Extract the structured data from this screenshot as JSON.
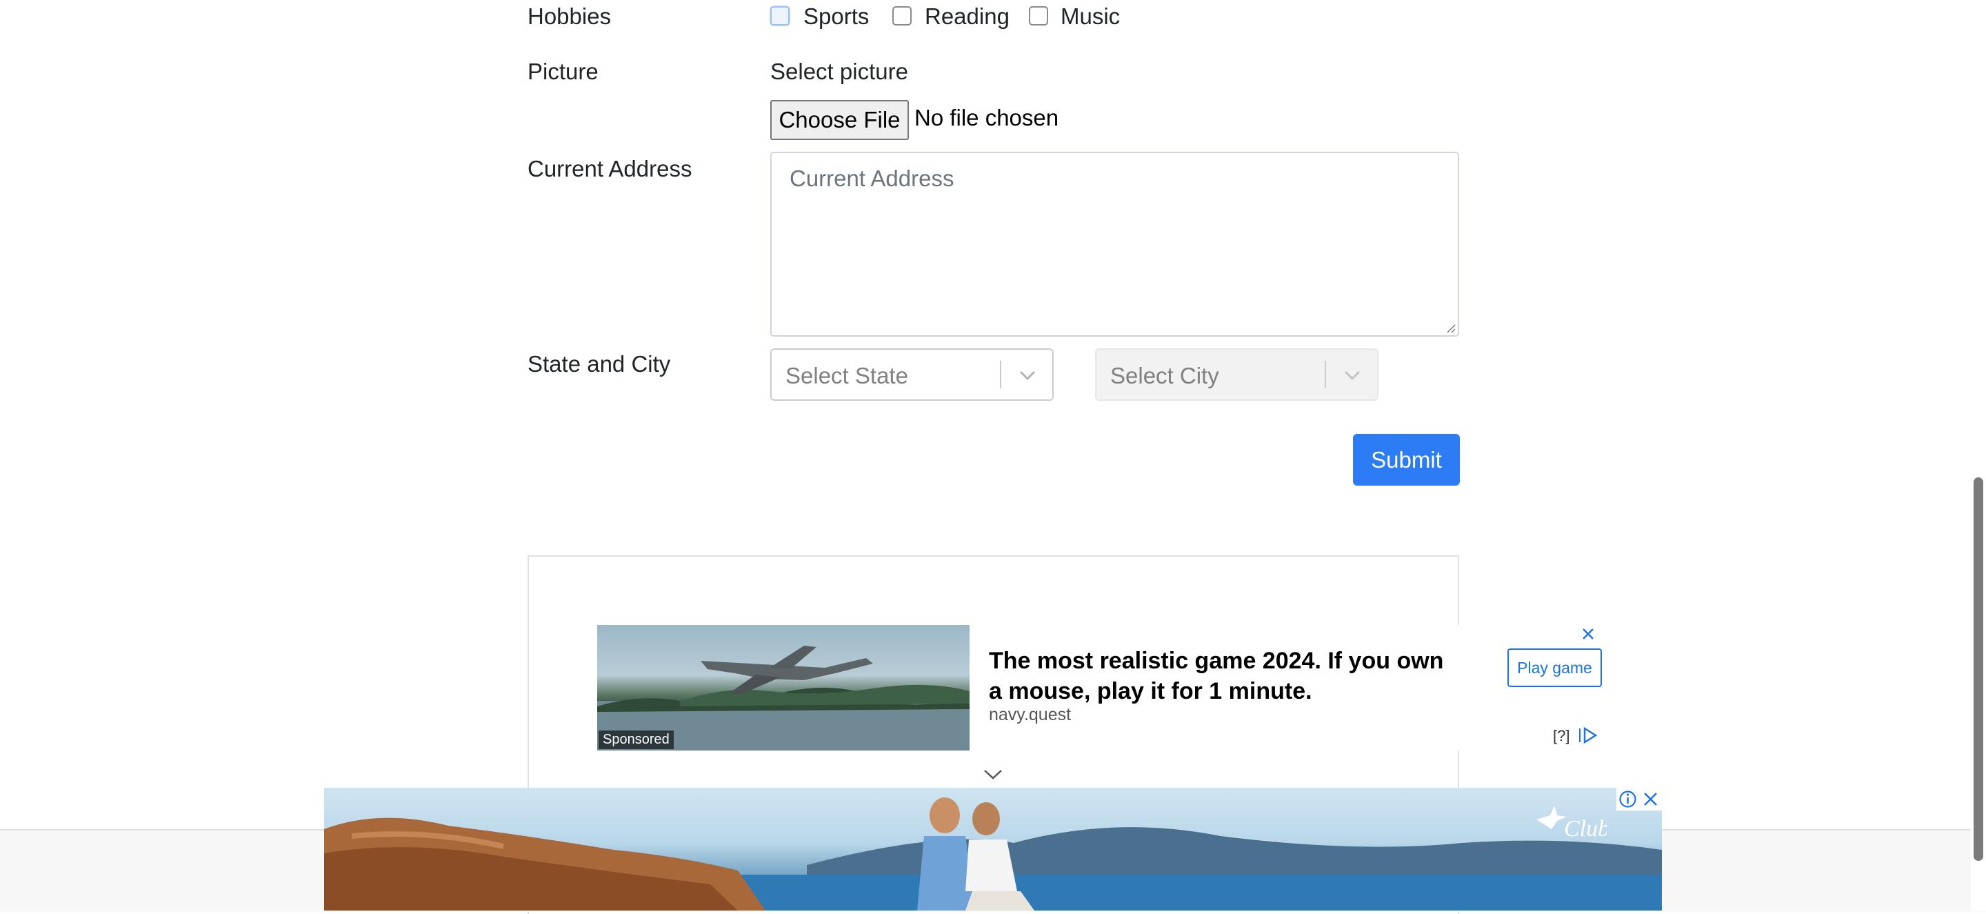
{
  "form": {
    "hobbies": {
      "label": "Hobbies",
      "options": [
        "Sports",
        "Reading",
        "Music"
      ]
    },
    "picture": {
      "label": "Picture",
      "select_label": "Select picture",
      "button_label": "Choose File",
      "status": "No file chosen"
    },
    "address": {
      "label": "Current Address",
      "placeholder": "Current Address"
    },
    "state_city": {
      "label": "State and City",
      "state_placeholder": "Select State",
      "city_placeholder": "Select City"
    },
    "submit_label": "Submit"
  },
  "native_ad": {
    "sponsored_label": "Sponsored",
    "title": "The most realistic game 2024. If you own a mouse, play it for 1 minute.",
    "domain": "navy.quest",
    "cta_label": "Play game",
    "help_label": "[?]"
  },
  "banner_ad": {
    "logo_text": "Club"
  },
  "colors": {
    "primary": "#2c7cf6",
    "text": "#212529",
    "placeholder": "#6c757d",
    "ad_link": "#1a73e8"
  }
}
